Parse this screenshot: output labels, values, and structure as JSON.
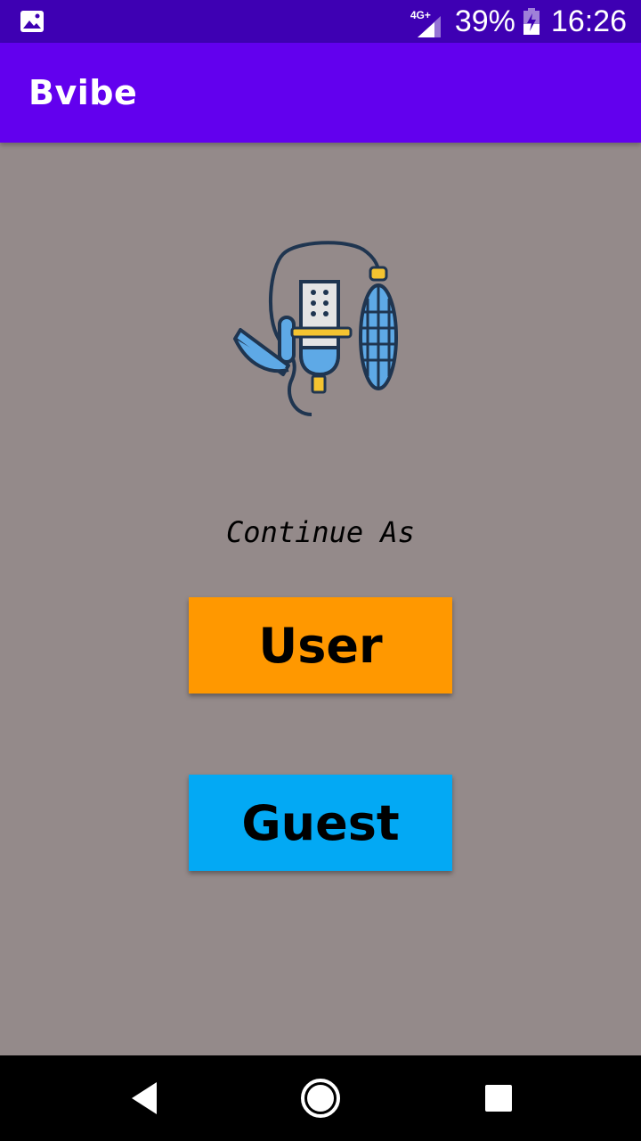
{
  "status_bar": {
    "network_type": "4G+",
    "battery_percent": "39%",
    "time": "16:26",
    "icons": [
      "image-notification-icon",
      "signal-icon",
      "battery-charging-icon"
    ]
  },
  "app_bar": {
    "title": "Bvibe"
  },
  "main": {
    "logo_icon": "microphone-logo-icon",
    "continue_label": "Continue As",
    "user_button_label": "User",
    "guest_button_label": "Guest"
  },
  "colors": {
    "status_bar": "#3e00b3",
    "app_bar": "#6200ee",
    "background": "#948a8a",
    "user_button": "#ff9800",
    "guest_button": "#03a9f4"
  },
  "nav_bar": {
    "icons": [
      "back-icon",
      "home-icon",
      "recents-icon"
    ]
  }
}
